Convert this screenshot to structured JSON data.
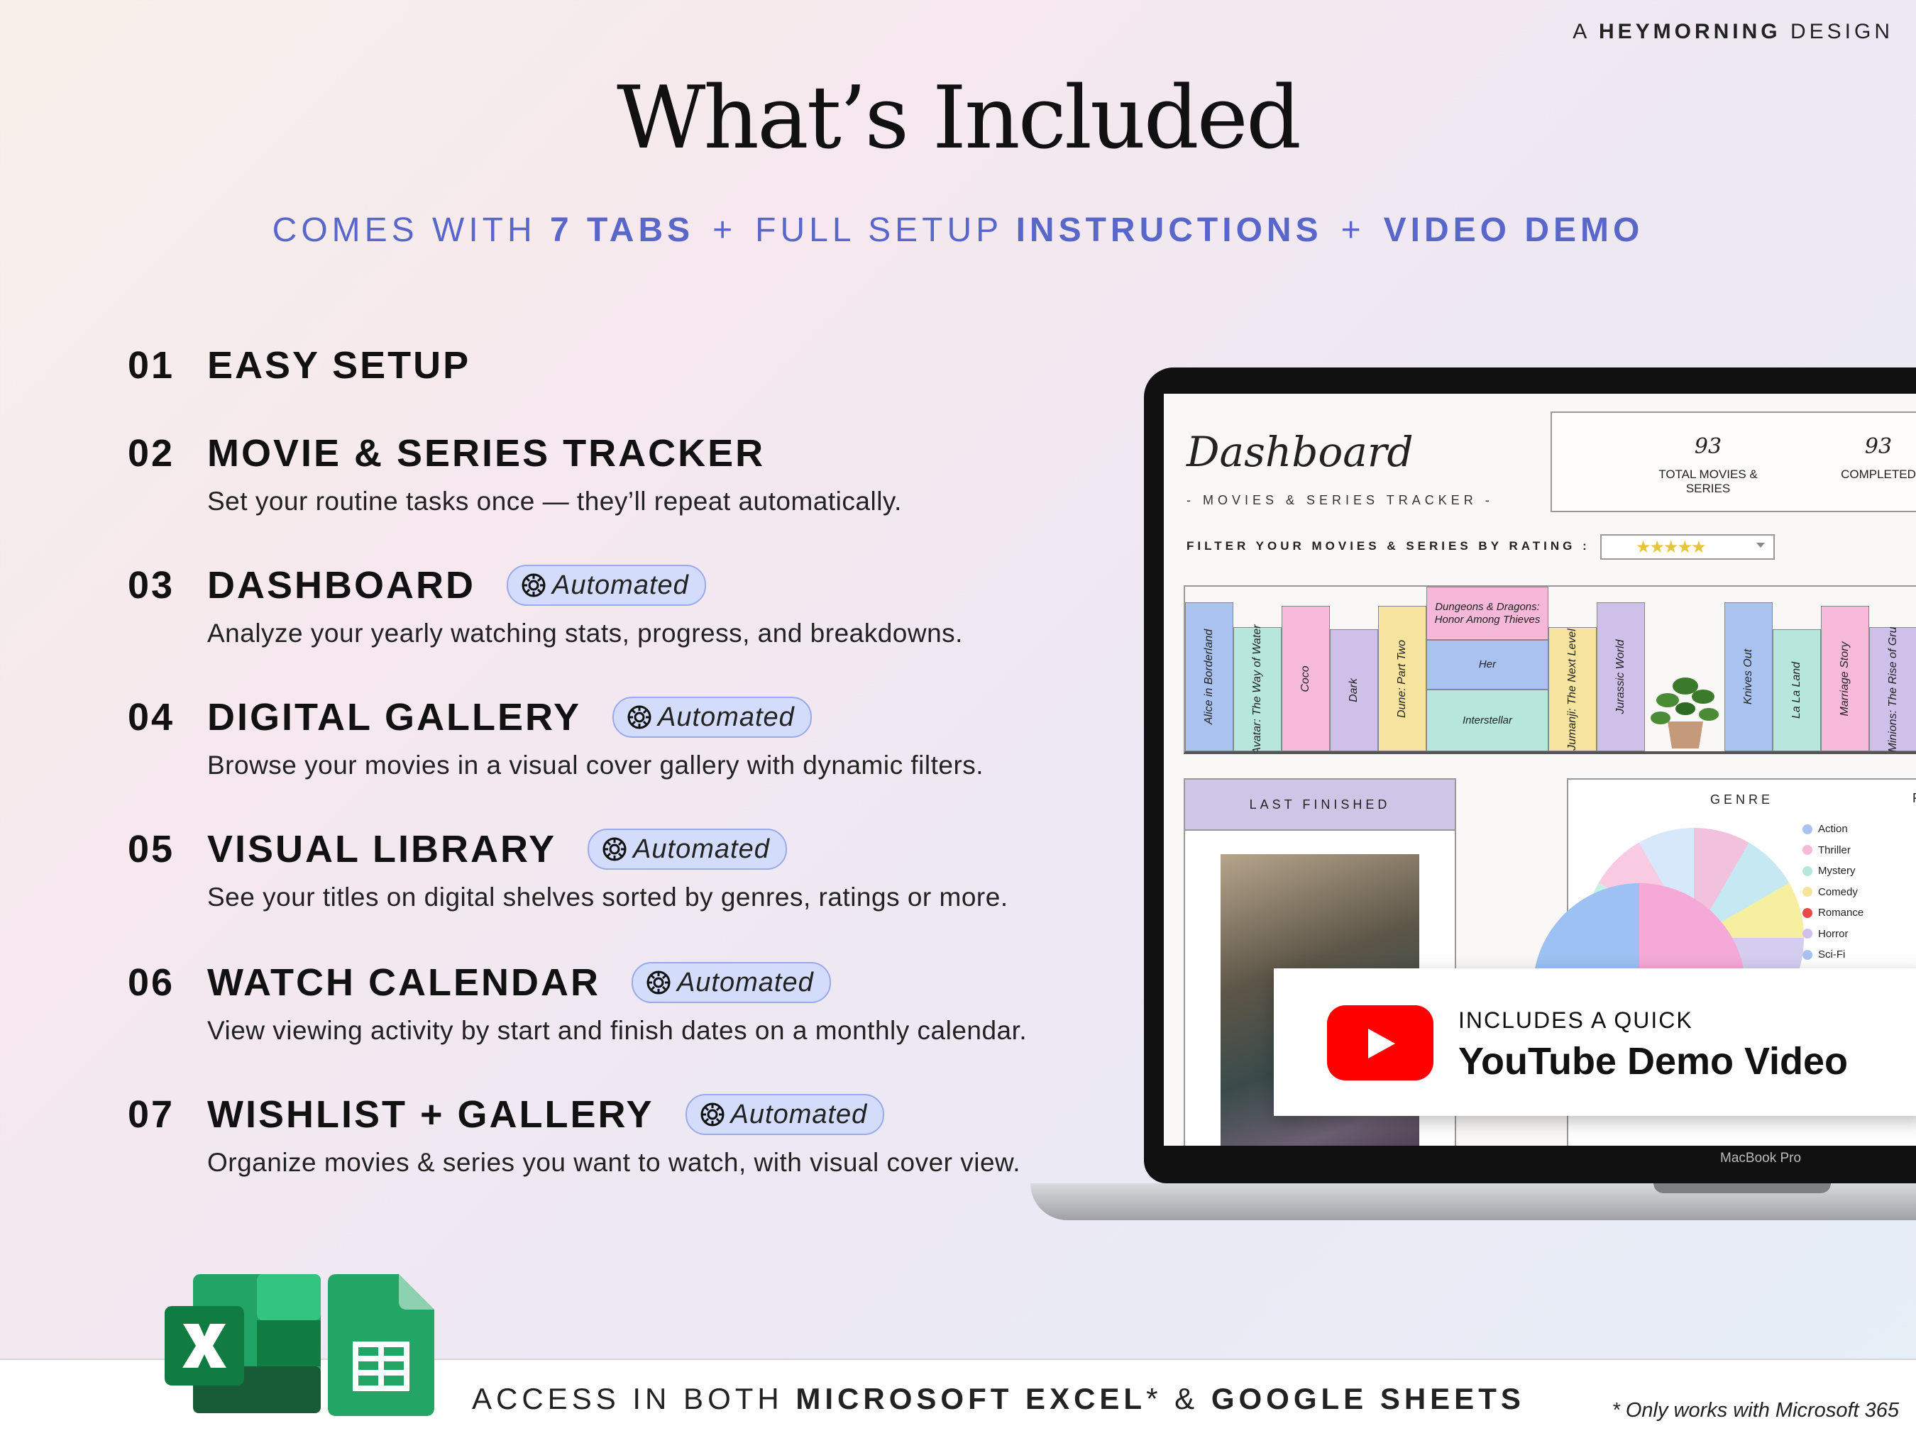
{
  "brand": {
    "prefix": "A",
    "name": "HEYMORNING",
    "suffix": "DESIGN"
  },
  "title": "What’s Included",
  "subtitle": {
    "part1": "COMES WITH",
    "bold1": "7 TABS",
    "plus": "+",
    "part2": "FULL SETUP",
    "bold2": "INSTRUCTIONS",
    "bold3": "VIDEO DEMO"
  },
  "features": [
    {
      "num": "01",
      "name": "EASY SETUP",
      "desc": "",
      "badge": ""
    },
    {
      "num": "02",
      "name": "MOVIE & SERIES TRACKER",
      "desc": "Set your routine tasks once — they’ll repeat automatically.",
      "badge": ""
    },
    {
      "num": "03",
      "name": "DASHBOARD",
      "desc": "Analyze your yearly watching stats, progress, and breakdowns.",
      "badge": "Automated"
    },
    {
      "num": "04",
      "name": "DIGITAL GALLERY",
      "desc": "Browse your movies in a visual cover gallery with dynamic filters.",
      "badge": "Automated"
    },
    {
      "num": "05",
      "name": "VISUAL LIBRARY",
      "desc": "See your titles on digital shelves sorted by genres, ratings or more.",
      "badge": "Automated"
    },
    {
      "num": "06",
      "name": "WATCH CALENDAR",
      "desc": "View viewing activity by start and finish dates on a monthly calendar.",
      "badge": "Automated"
    },
    {
      "num": "07",
      "name": "WISHLIST + GALLERY",
      "desc": "Organize movies & series you want to watch, with visual cover view.",
      "badge": "Automated"
    }
  ],
  "dashboard": {
    "title": "Dashboard",
    "subtitle": "- MOVIES & SERIES TRACKER -",
    "stats": [
      {
        "value": "93",
        "label": "TOTAL MOVIES & SERIES"
      },
      {
        "value": "93",
        "label": "COMPLETED"
      }
    ],
    "filter_label": "FILTER YOUR MOVIES & SERIES BY RATING :",
    "filter_value": "★★★★★",
    "books": [
      "Alice in Borderland",
      "Avatar: The Way of Water",
      "Coco",
      "Dark",
      "Dune: Part Two",
      "Dungeons & Dragons: Honor Among Thieves",
      "Her",
      "Interstellar",
      "Jumanji: The Next Level",
      "Jurassic World",
      "Knives Out",
      "La La Land",
      "Marriage Story",
      "Minions: The Rise of Gru"
    ],
    "last_finished": "LAST FINISHED",
    "genre_title": "GENRE",
    "genre_legend": [
      "Action",
      "Thriller",
      "Mystery",
      "Comedy",
      "Romance",
      "Horror",
      "Sci-Fi"
    ],
    "right_panel_initial": "R",
    "laptop_label": "MacBook Pro"
  },
  "youtube": {
    "small": "INCLUDES A QUICK",
    "big": "YouTube Demo Video"
  },
  "footer": {
    "access_prefix": "ACCESS IN BOTH",
    "excel": "MICROSOFT EXCEL",
    "star": "*",
    "amp": "&",
    "sheets": "GOOGLE SHEETS",
    "note": "* Only works with Microsoft 365"
  },
  "colors": {
    "accent": "#5867c9",
    "badge_bg": "#d3dcfa",
    "youtube_red": "#ff0000"
  }
}
